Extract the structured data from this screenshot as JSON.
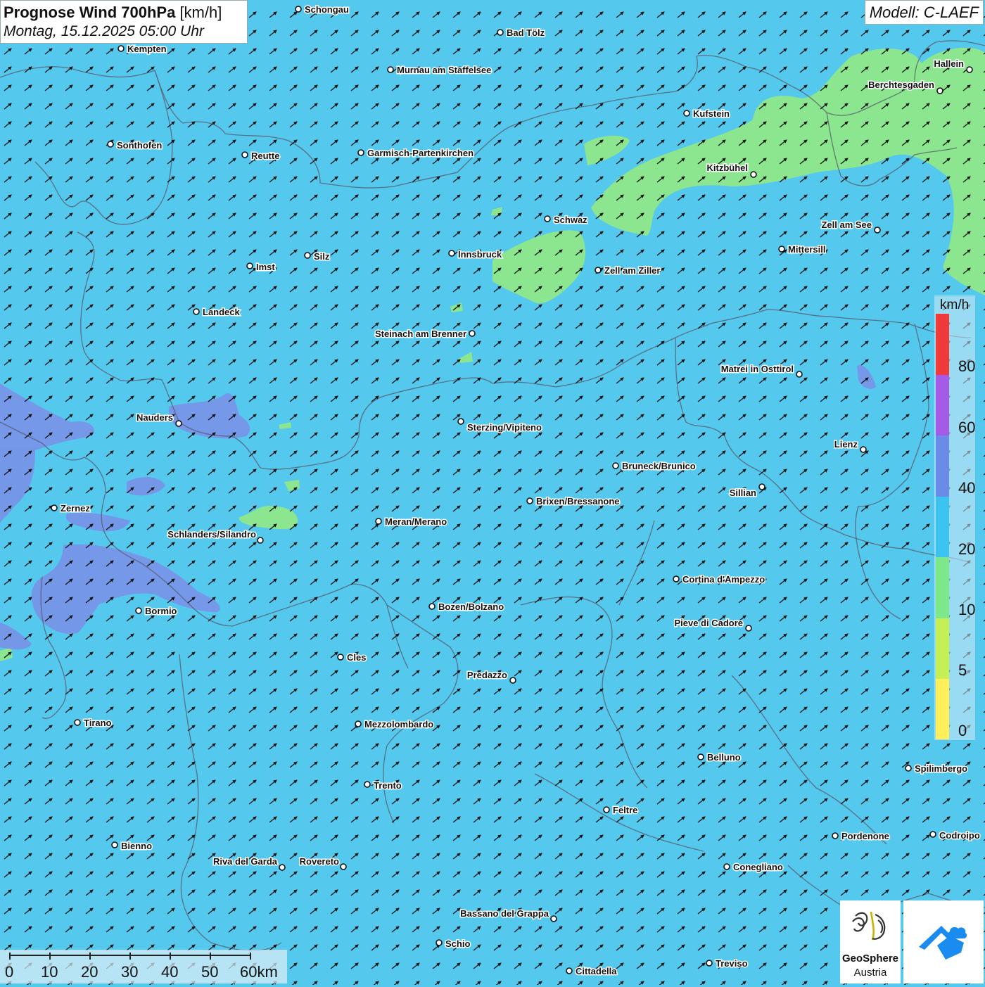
{
  "title": {
    "bold": "Prognose Wind 700hPa",
    "unit": "[km/h]",
    "datetime": "Montag, 15.12.2025 05:00 Uhr"
  },
  "model": "Modell: C-LAEF",
  "legend": {
    "unit": "km/h",
    "labels": [
      "80",
      "60",
      "40",
      "20",
      "10",
      "5",
      "0"
    ],
    "colors": [
      "#f03a3a",
      "#a55be6",
      "#6a8ce8",
      "#3dc3ef",
      "#7de88a",
      "#c4ef55",
      "#ffef5a"
    ]
  },
  "background_color": "#55c8ee",
  "wind_direction": "southwest",
  "cities": [
    "Schongau",
    "Bad Tölz",
    "Kempten",
    "Murnau am Staffelsee",
    "Hallein",
    "Berchtesgaden",
    "Kufstein",
    "Sonthofen",
    "Reutte",
    "Garmisch-Partenkirchen",
    "Kitzbühel",
    "Schwaz",
    "Zell am See",
    "Mittersill",
    "Innsbruck",
    "Silz",
    "Imst",
    "Zell am Ziller",
    "Landeck",
    "Steinach am Brenner",
    "Matrei in Osttirol",
    "Nauders",
    "Sterzing/Vipiteno",
    "Lienz",
    "Bruneck/Brunico",
    "Sillian",
    "Zernez",
    "Brixen/Bressanone",
    "Meran/Merano",
    "Schlanders/Silandro",
    "Cortina d'Ampezzo",
    "Bormio",
    "Bozen/Bolzano",
    "Pieve di Cadore",
    "Cles",
    "Predazzo",
    "Tirano",
    "Mezzolombardo",
    "Belluno",
    "Spilimbergo",
    "Trento",
    "Feltre",
    "Pordenone",
    "Codroipo",
    "Bienno",
    "Riva del Garda",
    "Rovereto",
    "Conegliano",
    "Bassano del Grappa",
    "Schio",
    "Treviso",
    "Cittadella"
  ],
  "scalebar": {
    "labels": [
      "0",
      "10",
      "20",
      "30",
      "40",
      "50",
      "60km"
    ]
  },
  "logo": {
    "brand": "GeoSphere",
    "sub": "Austria"
  }
}
